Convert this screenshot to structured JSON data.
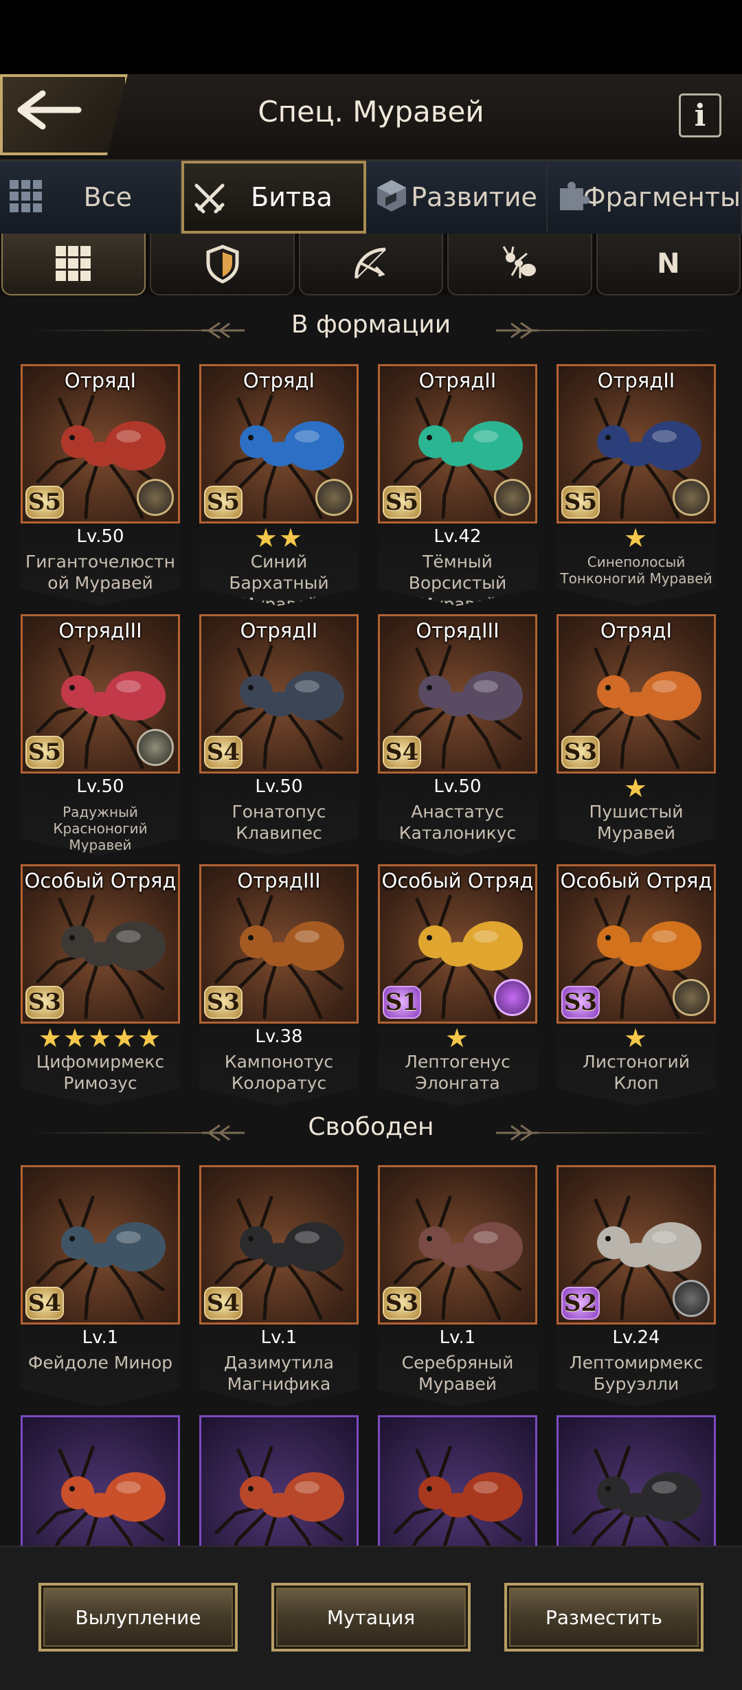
{
  "header": {
    "title": "Спец. Муравей",
    "info_label": "i"
  },
  "tabs": [
    {
      "label": "Все",
      "icon": "grid-icon"
    },
    {
      "label": "Битва",
      "icon": "crossed-swords-icon",
      "active": true
    },
    {
      "label": "Развитие",
      "icon": "cube-icon"
    },
    {
      "label": "Фрагменты",
      "icon": "puzzle-icon"
    }
  ],
  "filters": [
    {
      "icon": "grid-icon",
      "active": true
    },
    {
      "icon": "shield-icon"
    },
    {
      "icon": "bow-icon"
    },
    {
      "icon": "ant-icon"
    },
    {
      "label": "N"
    }
  ],
  "sections": {
    "in_formation": "В формации",
    "free": "Свободен"
  },
  "formation": [
    {
      "squad": "ОтрядI",
      "grade": "S5",
      "level": "Lv.50",
      "stars": "",
      "name": "Гиганточелюстн ой Муравей",
      "color": "#b0382a"
    },
    {
      "squad": "ОтрядI",
      "grade": "S5",
      "level": "",
      "stars": "★★",
      "name": "Синий Бархатный Муравей",
      "color": "#2c6fc4"
    },
    {
      "squad": "ОтрядII",
      "grade": "S5",
      "level": "Lv.42",
      "stars": "",
      "name": "Тёмный Ворсистый Муравей",
      "color": "#2bb592"
    },
    {
      "squad": "ОтрядII",
      "grade": "S5",
      "level": "",
      "stars": "★",
      "name": "Синеполосый Тонконогий Муравей",
      "color": "#2c3f7a"
    },
    {
      "squad": "ОтрядIII",
      "grade": "S5",
      "level": "Lv.50",
      "stars": "",
      "name": "Радужный Красноногий Муравей",
      "color": "#c23a4a"
    },
    {
      "squad": "ОтрядII",
      "grade": "S4",
      "level": "Lv.50",
      "stars": "",
      "name": "Гонатопус Клавипес",
      "color": "#3b4556"
    },
    {
      "squad": "ОтрядIII",
      "grade": "S4",
      "level": "Lv.50",
      "stars": "",
      "name": "Анастатус Каталоникус",
      "color": "#5a4b63"
    },
    {
      "squad": "ОтрядI",
      "grade": "S3",
      "level": "",
      "stars": "★",
      "name": "Пушистый Муравей",
      "color": "#d06a26"
    },
    {
      "squad": "Особый Отряд",
      "grade": "S3",
      "level": "",
      "stars": "★★★★★",
      "name": "Цифомирмекс Римозус",
      "color": "#3d3a36"
    },
    {
      "squad": "ОтрядIII",
      "grade": "S3",
      "level": "Lv.38",
      "stars": "",
      "name": "Кампонотус Колоратус",
      "color": "#a55a22"
    },
    {
      "squad": "Особый Отряд",
      "grade": "S1",
      "level": "",
      "stars": "★",
      "name": "Лептогенус Элонгата",
      "color": "#e0a630"
    },
    {
      "squad": "Особый Отряд",
      "grade": "S3",
      "level": "",
      "stars": "★",
      "name": "Листоногий Клоп",
      "color": "#d2721c"
    }
  ],
  "free": [
    {
      "grade": "S4",
      "level": "Lv.1",
      "name": "Фейдоле Минор",
      "color": "#3f5566"
    },
    {
      "grade": "S4",
      "level": "Lv.1",
      "name": "Дазимутила Магнифика",
      "color": "#2b2b2e"
    },
    {
      "grade": "S3",
      "level": "Lv.1",
      "name": "Серебряный Муравей",
      "color": "#7a4b45"
    },
    {
      "grade": "S2",
      "level": "Lv.24",
      "name": "Лептомирмекс Буруэлли",
      "color": "#b9b5ac"
    }
  ],
  "partial": [
    {
      "color": "#c9502a"
    },
    {
      "color": "#b9482a"
    },
    {
      "color": "#a8391e"
    },
    {
      "color": "#2a2a2c"
    }
  ],
  "buttons": {
    "molt": "Вылупление",
    "mutation": "Мутация",
    "deploy": "Разместить"
  }
}
